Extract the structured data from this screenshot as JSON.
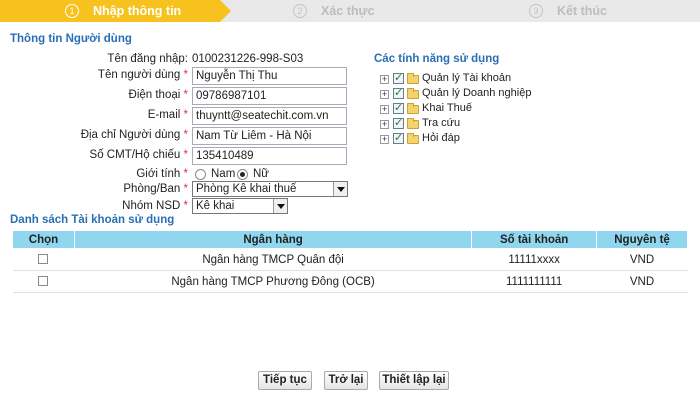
{
  "wizard": {
    "steps": [
      {
        "num": "1",
        "label": "Nhập thông tin"
      },
      {
        "num": "2",
        "label": "Xác thực"
      },
      {
        "num": "3",
        "label": "Kết thúc"
      }
    ]
  },
  "user_info": {
    "title": "Thông tin Người dùng",
    "login_label": "Tên đăng nhập:",
    "login_value": "0100231226-998-S03",
    "name_label": "Tên người dùng",
    "name_value": "Nguyễn Thị Thu",
    "phone_label": "Điện thoại",
    "phone_value": "09786987101",
    "email_label": "E-mail",
    "email_value": "thuyntt@seatechit.com.vn",
    "address_label": "Địa chỉ Người dùng",
    "address_value": "Nam Từ Liêm - Hà Nội",
    "id_label": "Số CMT/Hộ chiếu",
    "id_value": "135410489",
    "gender_label": "Giới tính",
    "gender_male": "Nam",
    "gender_female": "Nữ",
    "gender_selected": "Nữ",
    "dept_label": "Phòng/Ban",
    "dept_value": "Phòng Kê khai thuế",
    "group_label": "Nhóm NSD",
    "group_value": "Kê khai",
    "required_mark": "*"
  },
  "features": {
    "title": "Các tính năng sử dụng",
    "items": [
      "Quản lý Tài khoản",
      "Quản lý Doanh nghiệp",
      "Khai Thuế",
      "Tra cứu",
      "Hỏi đáp"
    ],
    "expander": "+"
  },
  "accounts": {
    "title": "Danh sách Tài khoản sử dụng",
    "columns": [
      "Chọn",
      "Ngân hàng",
      "Số tài khoản",
      "Nguyên tệ"
    ],
    "rows": [
      {
        "bank": "Ngân hàng TMCP Quân đội",
        "number": "11111xxxx",
        "currency": "VND"
      },
      {
        "bank": "Ngân hàng TMCP Phương Đông (OCB)",
        "number": "1111111111",
        "currency": "VND"
      }
    ]
  },
  "buttons": {
    "continue": "Tiếp tục",
    "back": "Trở lại",
    "reset": "Thiết lập lại"
  },
  "colors": {
    "active_step": "#f7c21e",
    "section_title": "#2a6fb5",
    "table_header": "#8fd6ee",
    "required": "#e03030"
  }
}
